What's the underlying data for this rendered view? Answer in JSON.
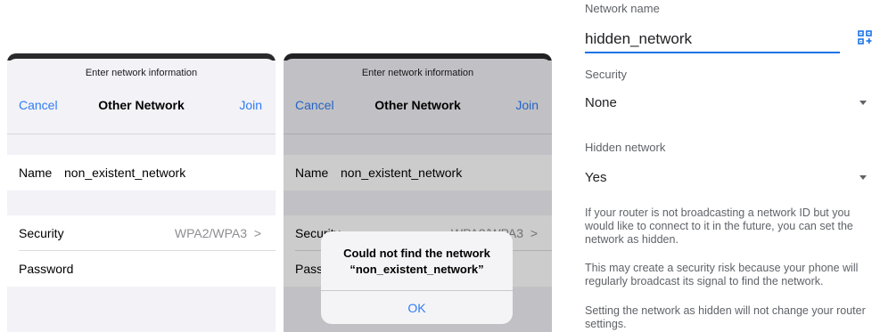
{
  "ios_form": {
    "prompt": "Enter network information",
    "cancel": "Cancel",
    "title": "Other Network",
    "join": "Join",
    "name_label": "Name",
    "name_value": "non_existent_network",
    "security_label": "Security",
    "security_value": "WPA2/WPA3",
    "chevron": ">",
    "password_label": "Password"
  },
  "ios_alert": {
    "message_line1": "Could not find the network",
    "message_line2": "“non_existent_network”",
    "ok": "OK"
  },
  "android_form": {
    "network_name_label": "Network name",
    "network_name_value": "hidden_network",
    "security_label": "Security",
    "security_value": "None",
    "hidden_label": "Hidden network",
    "hidden_value": "Yes",
    "info_1": "If your router is not broadcasting a network ID but you would like to connect to it in the future, you can set the network as hidden.",
    "info_2": "This may create a security risk because your phone will regularly broadcast its signal to find the network.",
    "info_3": "Setting the network as hidden will not change your router settings.",
    "qr_icon": "qr-scan-icon"
  },
  "colors": {
    "ios_blue": "#2f7cf6",
    "android_accent": "#1a73e8"
  }
}
